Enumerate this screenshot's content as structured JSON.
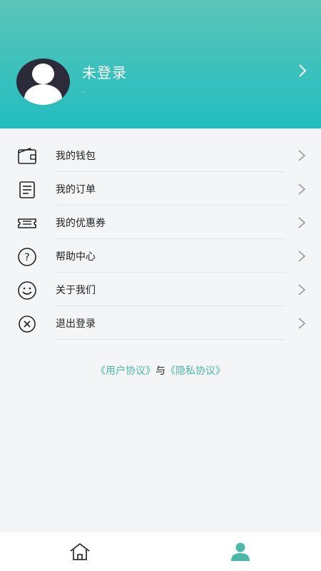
{
  "user": {
    "name": "未登录",
    "subtitle": "·"
  },
  "menu": [
    {
      "label": "我的钱包",
      "icon": "wallet-icon"
    },
    {
      "label": "我的订单",
      "icon": "order-icon"
    },
    {
      "label": "我的优惠券",
      "icon": "coupon-icon"
    },
    {
      "label": "帮助中心",
      "icon": "help-icon"
    },
    {
      "label": "关于我们",
      "icon": "smile-icon"
    },
    {
      "label": "退出登录",
      "icon": "logout-icon"
    }
  ],
  "agreement": {
    "user_agreement": "《用户协议》",
    "and": "与",
    "privacy": "《隐私协议》"
  },
  "tabbar": {
    "tabs": [
      {
        "icon": "home-icon"
      },
      {
        "icon": "profile-icon"
      }
    ]
  },
  "colors": {
    "accent": "#4cb8a8",
    "header_top": "#5ac5b7",
    "header_bottom": "#22bdc0"
  }
}
